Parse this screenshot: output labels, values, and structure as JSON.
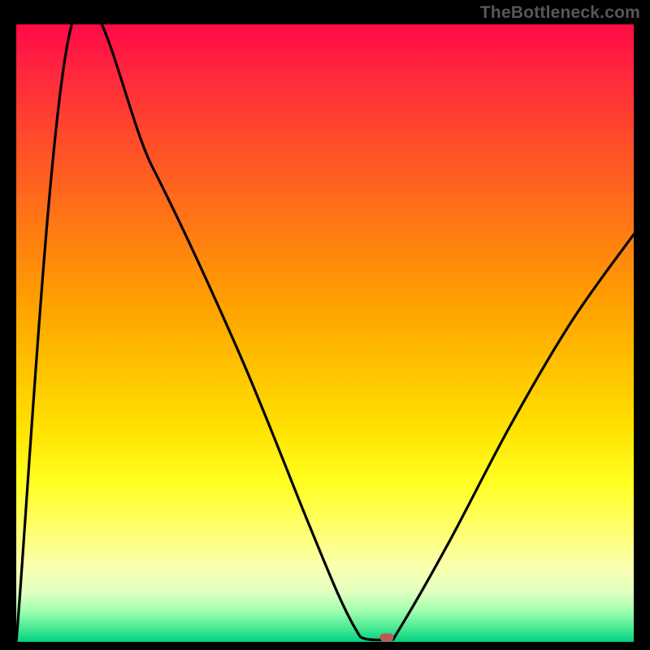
{
  "watermark": "TheBottleneck.com",
  "chart_data": {
    "type": "line",
    "title": "",
    "xlabel": "",
    "ylabel": "",
    "xlim": [
      0,
      100
    ],
    "ylim": [
      0,
      100
    ],
    "grid": false,
    "curve": [
      {
        "x": 0,
        "y": 0
      },
      {
        "x": 9,
        "y": 100
      },
      {
        "x": 22,
        "y": 77
      },
      {
        "x": 36,
        "y": 47
      },
      {
        "x": 47,
        "y": 20
      },
      {
        "x": 52,
        "y": 8
      },
      {
        "x": 55,
        "y": 2
      },
      {
        "x": 56.5,
        "y": 0.5
      },
      {
        "x": 60.5,
        "y": 0.5
      },
      {
        "x": 62,
        "y": 2
      },
      {
        "x": 70,
        "y": 16
      },
      {
        "x": 80,
        "y": 35
      },
      {
        "x": 90,
        "y": 52
      },
      {
        "x": 100,
        "y": 66
      }
    ],
    "marker": {
      "x": 60,
      "y": 0.7,
      "color": "#b95a55"
    }
  }
}
